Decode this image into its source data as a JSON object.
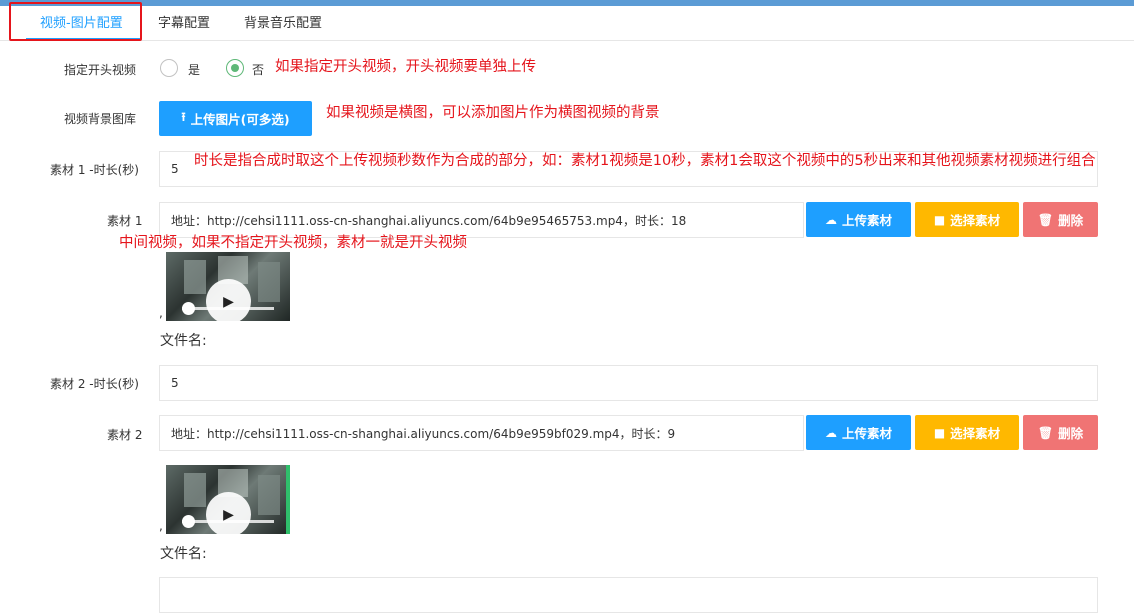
{
  "tabs": [
    {
      "label": "视频-图片配置"
    },
    {
      "label": "字幕配置"
    },
    {
      "label": "背景音乐配置"
    }
  ],
  "form": {
    "opening_video": {
      "label": "指定开头视频",
      "options": [
        "是",
        "否"
      ],
      "selected": "否",
      "note": "如果指定开头视频，开头视频要单独上传"
    },
    "bg_gallery": {
      "label": "视频背景图库",
      "button": "上传图片(可多选)",
      "note": "如果视频是横图，可以添加图片作为横图视频的背景"
    },
    "materials": [
      {
        "duration_label": "素材 1 -时长(秒)",
        "duration_value": "5",
        "duration_note": "时长是指合成时取这个上传视频秒数作为合成的部分，如：素材1视频是10秒，素材1会取这个视频中的5秒出来和其他视频素材视频进行组合",
        "label": "素材 1",
        "address": "地址：http://cehsi1111.oss-cn-shanghai.aliyuncs.com/64b9e95465753.mp4，时长：18",
        "note": "中间视频，如果不指定开头视频，素材一就是开头视频",
        "comma": ",",
        "filename_label": "文件名:"
      },
      {
        "duration_label": "素材 2 -时长(秒)",
        "duration_value": "5",
        "label": "素材 2",
        "address": "地址：http://cehsi1111.oss-cn-shanghai.aliyuncs.com/64b9e959bf029.mp4，时长：9",
        "comma": ",",
        "filename_label": "文件名:"
      }
    ],
    "buttons": {
      "upload": "上传素材",
      "select": "选择素材",
      "delete": "删除"
    }
  },
  "colors": {
    "accent": "#1e9fff",
    "warning": "#ffb800",
    "danger": "#f07474",
    "annotation": "#e5151c",
    "radio_checked": "#5fb878"
  }
}
